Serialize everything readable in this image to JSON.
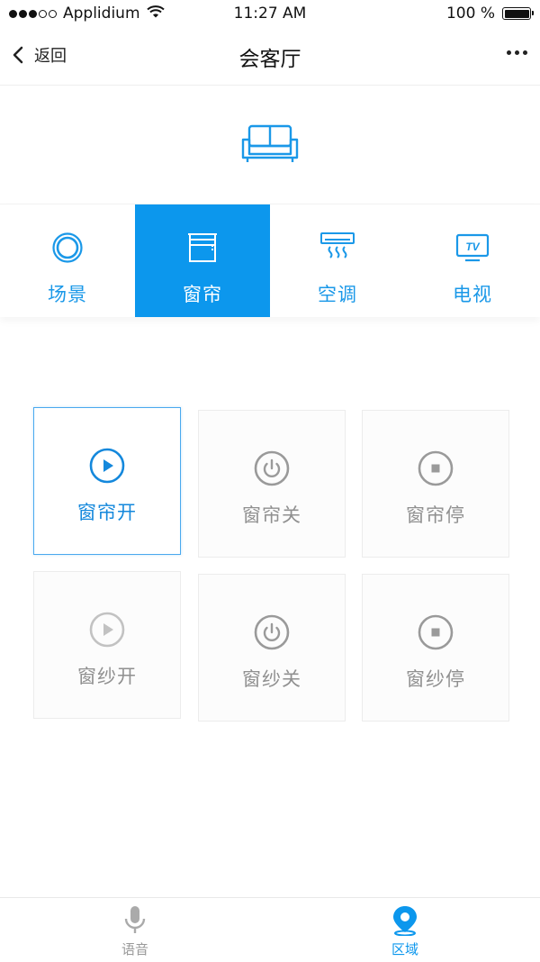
{
  "status_bar": {
    "carrier": "Applidium",
    "time": "11:27 AM",
    "battery": "100 %"
  },
  "nav": {
    "back_label": "返回",
    "title": "会客厅"
  },
  "tabs": [
    {
      "label": "场景",
      "icon": "scene-ring-icon",
      "active": false
    },
    {
      "label": "窗帘",
      "icon": "curtain-icon",
      "active": true
    },
    {
      "label": "空调",
      "icon": "air-conditioner-icon",
      "active": false
    },
    {
      "label": "电视",
      "icon": "tv-icon",
      "active": false
    },
    {
      "tv_text": "TV"
    }
  ],
  "controls": [
    {
      "label": "窗帘开",
      "icon": "play-icon",
      "active": true
    },
    {
      "label": "窗帘关",
      "icon": "power-icon",
      "active": false
    },
    {
      "label": "窗帘停",
      "icon": "stop-icon",
      "active": false
    },
    {
      "label": "窗纱开",
      "icon": "play-icon",
      "active": false
    },
    {
      "label": "窗纱关",
      "icon": "power-icon",
      "active": false
    },
    {
      "label": "窗纱停",
      "icon": "stop-icon",
      "active": false
    }
  ],
  "tabbar": {
    "voice_label": "语音",
    "area_label": "区域"
  },
  "colors": {
    "accent": "#0c97ed",
    "tab_text": "#1a98e8",
    "inactive_text": "#909090",
    "tabbar_inactive": "#aaaaaa"
  }
}
